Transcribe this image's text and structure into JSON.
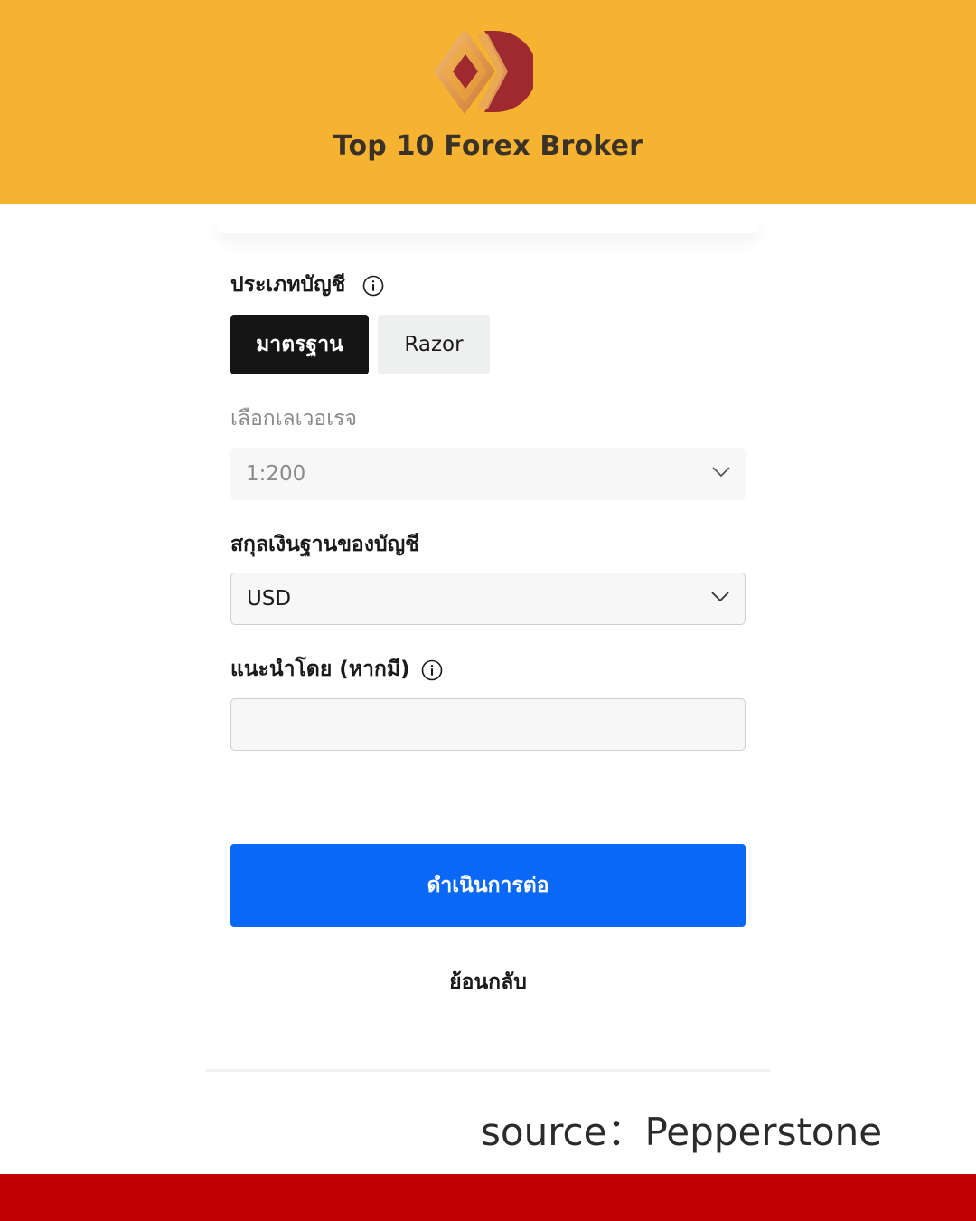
{
  "header": {
    "brand_title": "Top 10 Forex Broker",
    "background_color": "#f6b331",
    "logo_icon": "diamond-chevron-logo-icon"
  },
  "form": {
    "account_type": {
      "label": "ประเภทบัญชี",
      "info_icon": "info-icon",
      "options": [
        {
          "label": "มาตรฐาน",
          "selected": true
        },
        {
          "label": "Razor",
          "selected": false
        }
      ]
    },
    "leverage": {
      "label": "เลือกเลเวอเรจ",
      "value": "1:200",
      "disabled": true
    },
    "base_currency": {
      "label": "สกุลเงินฐานของบัญชี",
      "value": "USD"
    },
    "referral": {
      "label": "แนะนำโดย (หากมี)",
      "info_icon": "info-icon",
      "value": ""
    },
    "continue_label": "ดำเนินการต่อ",
    "continue_color": "#0a68f6",
    "back_label": "ย้อนกลับ"
  },
  "footer": {
    "source_text": "source：Pepperstone",
    "bar_color": "#c00000"
  }
}
